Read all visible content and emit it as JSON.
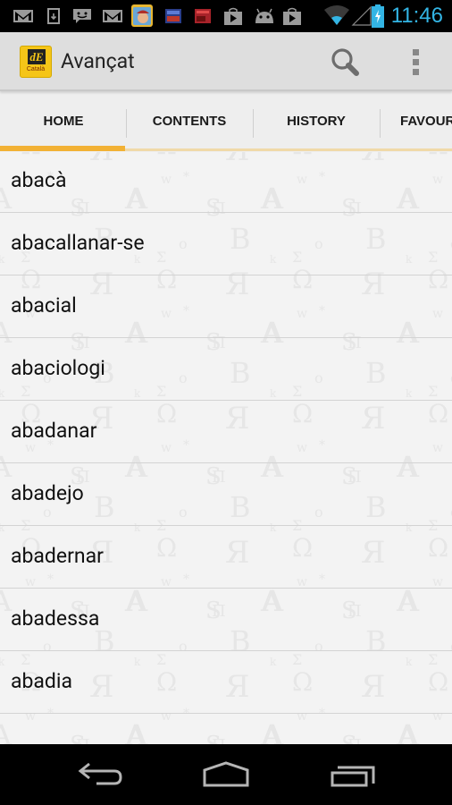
{
  "status_bar": {
    "time": "11:46",
    "notification_icons": [
      "gmail-icon",
      "download-icon",
      "messenger-icon",
      "gmail-icon",
      "subway-surfers-app-icon",
      "app-icon",
      "app-icon",
      "play-store-icon",
      "android-icon",
      "play-store-icon"
    ],
    "system_icons": [
      "wifi-icon",
      "cell-signal-icon",
      "battery-charging-icon"
    ],
    "accent_color": "#33b5e5"
  },
  "action_bar": {
    "app_logo": {
      "mark": "dE",
      "sub": "Català"
    },
    "title": "Avançat",
    "actions": [
      {
        "name": "search",
        "icon": "search-icon"
      },
      {
        "name": "overflow-menu",
        "icon": "more-vert-icon"
      }
    ]
  },
  "tabs": {
    "items": [
      {
        "label": "HOME",
        "active": true
      },
      {
        "label": "CONTENTS",
        "active": false
      },
      {
        "label": "HISTORY",
        "active": false
      },
      {
        "label": "FAVOURITES",
        "active": false
      }
    ],
    "accent_color": "#f2b134"
  },
  "list": {
    "items": [
      "abacà",
      "abacallanar-se",
      "abacial",
      "abaciologi",
      "abadanar",
      "abadejo",
      "abadernar",
      "abadessa",
      "abadia"
    ]
  },
  "nav_bar": {
    "buttons": [
      {
        "name": "back",
        "icon": "back-icon"
      },
      {
        "name": "home",
        "icon": "home-icon"
      },
      {
        "name": "recents",
        "icon": "recents-icon"
      }
    ]
  }
}
